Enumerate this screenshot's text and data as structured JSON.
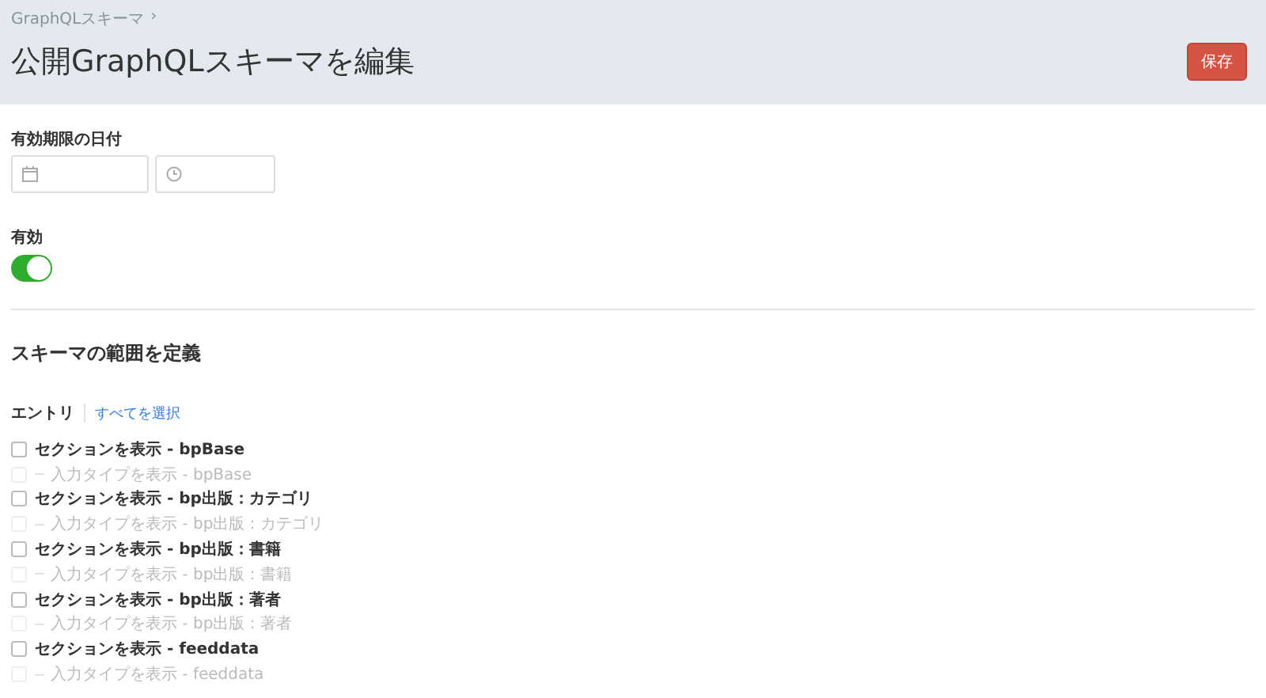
{
  "header": {
    "breadcrumb": "GraphQLスキーマ",
    "breadcrumb_separator": "›",
    "title": "公開GraphQLスキーマを編集",
    "save_button": "保存"
  },
  "expiry": {
    "label": "有効期限の日付"
  },
  "enabled": {
    "label": "有効",
    "on": true
  },
  "scope": {
    "heading": "スキーマの範囲を定義",
    "entries_label": "エントリ",
    "select_all": "すべてを選択",
    "rows": [
      {
        "kind": "section",
        "label": "セクションを表示 - bpBase",
        "checked": false,
        "disabled": false
      },
      {
        "kind": "subtype",
        "label": "入力タイプを表示 - bpBase",
        "checked": false,
        "disabled": true
      },
      {
        "kind": "section",
        "label": "セクションを表示 - bp出版：カテゴリ",
        "checked": false,
        "disabled": false
      },
      {
        "kind": "subtype",
        "label": "入力タイプを表示 - bp出版：カテゴリ",
        "checked": false,
        "disabled": true
      },
      {
        "kind": "section",
        "label": "セクションを表示 - bp出版：書籍",
        "checked": false,
        "disabled": false
      },
      {
        "kind": "subtype",
        "label": "入力タイプを表示 - bp出版：書籍",
        "checked": false,
        "disabled": true
      },
      {
        "kind": "section",
        "label": "セクションを表示 - bp出版：著者",
        "checked": false,
        "disabled": false
      },
      {
        "kind": "subtype",
        "label": "入力タイプを表示 - bp出版：著者",
        "checked": false,
        "disabled": true
      },
      {
        "kind": "section",
        "label": "セクションを表示 - feeddata",
        "checked": false,
        "disabled": false
      },
      {
        "kind": "subtype",
        "label": "入力タイプを表示 - feeddata",
        "checked": false,
        "disabled": true
      }
    ]
  }
}
